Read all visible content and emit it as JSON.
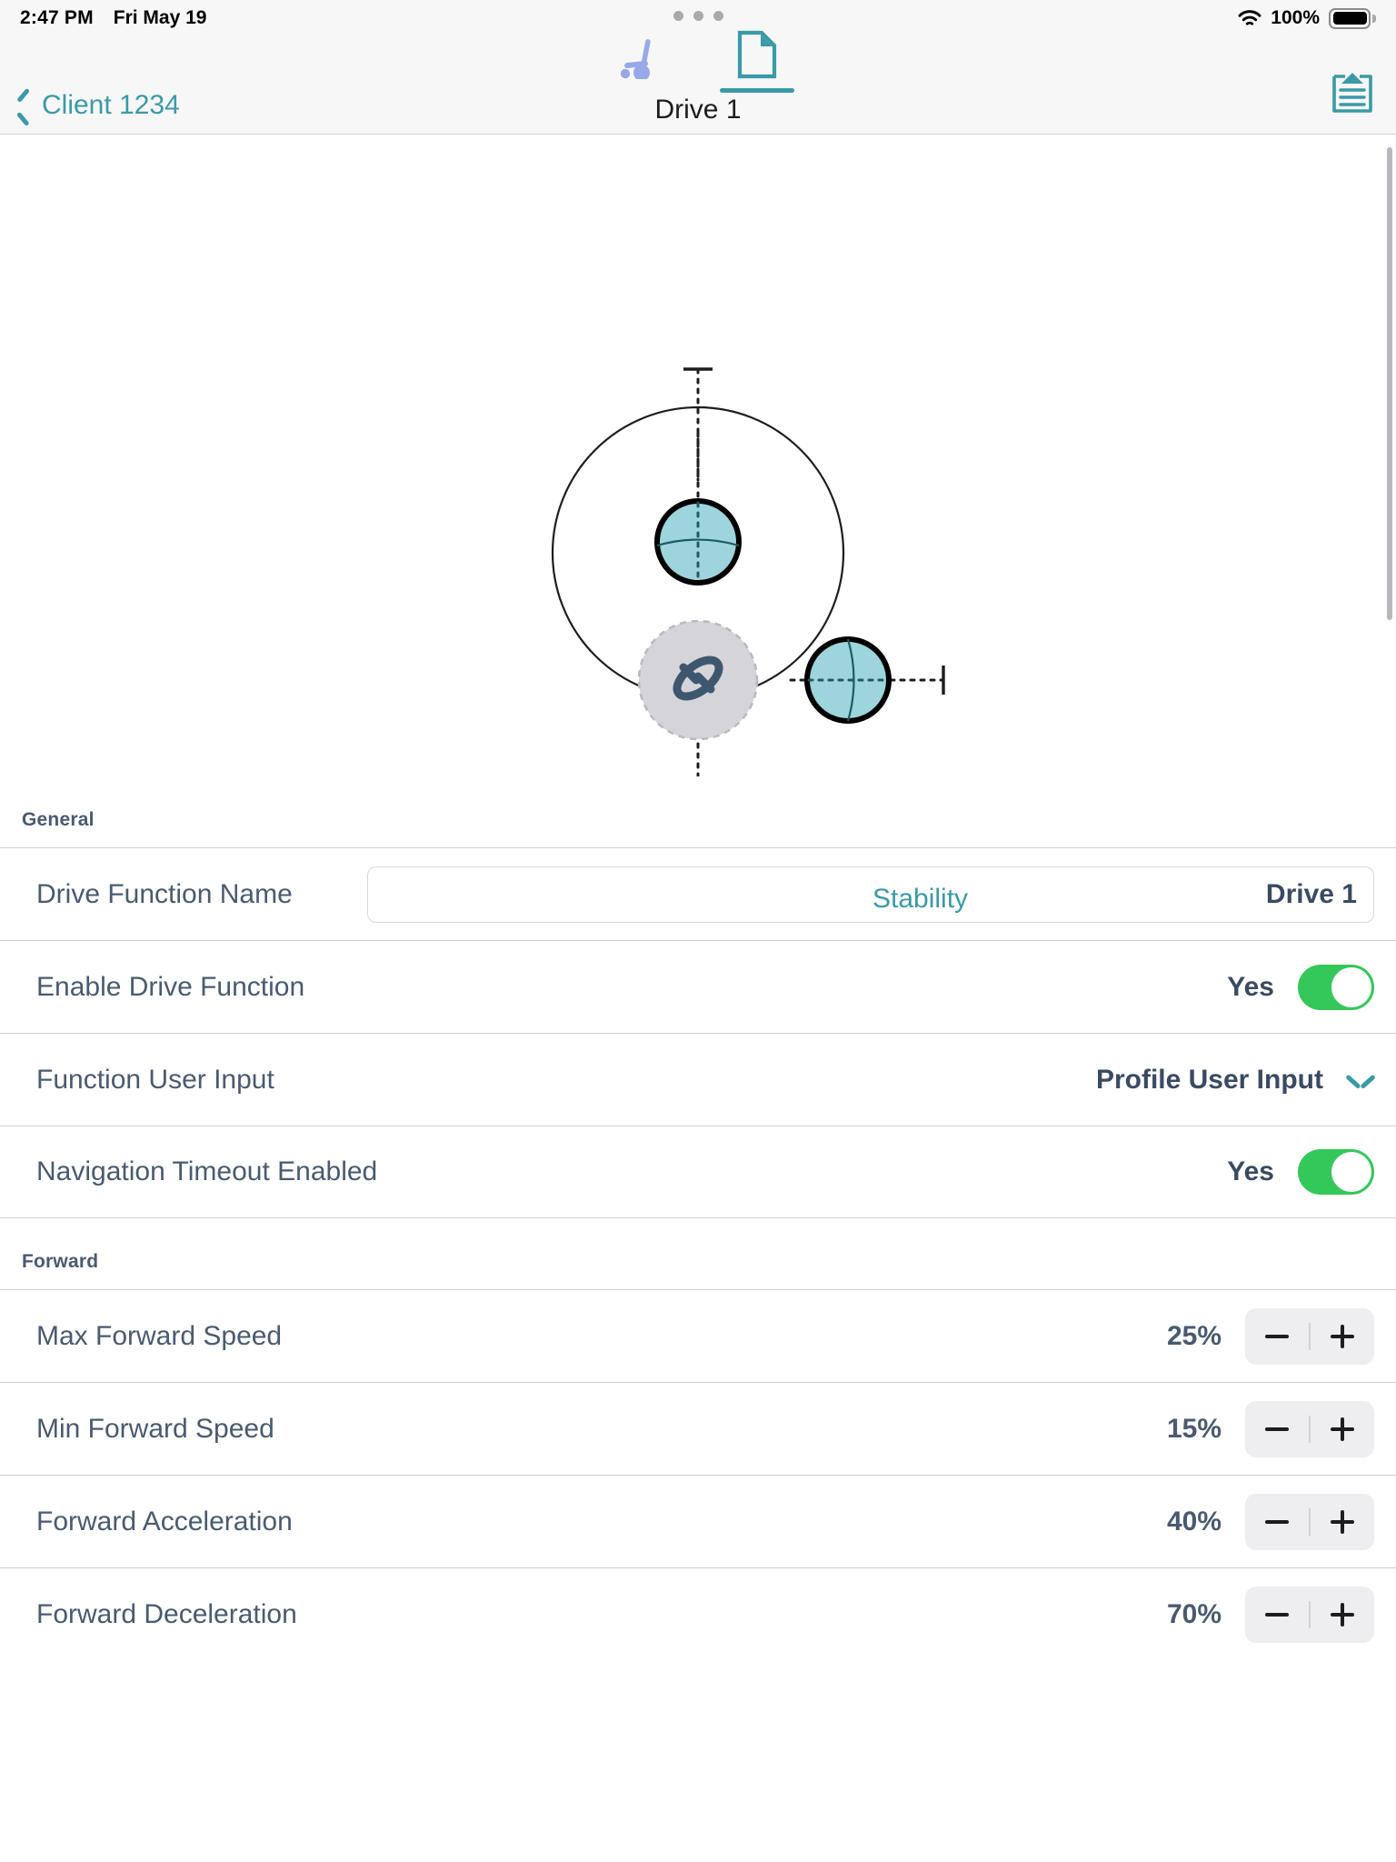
{
  "status_bar": {
    "time": "2:47 PM",
    "date": "Fri May 19",
    "battery_percent": "100%",
    "wifi_icon": "wifi-icon",
    "battery_icon": "battery-full-icon",
    "multitask_handle_icon": "three-dots-icon"
  },
  "nav": {
    "back_label": "Client 1234",
    "back_icon": "chevron-left-icon",
    "title": "Drive 1",
    "tabs": [
      {
        "icon": "wheelchair-icon",
        "name": "tab-wheelchair",
        "active": false
      },
      {
        "icon": "document-icon",
        "name": "tab-document",
        "active": true
      }
    ],
    "right_action_icon": "clipboard-list-icon"
  },
  "diagram": {
    "label": "Stability",
    "center_icon": "stability-orbit-icon",
    "nodes": [
      "top",
      "right",
      "bottom"
    ],
    "colors": {
      "node_fill": "#9ed4db",
      "node_stroke": "#000000",
      "center_fill": "#d4d4d9",
      "center_glyph": "#3f566f",
      "accent": "#3a9aa7"
    }
  },
  "sections": [
    {
      "title": "General",
      "rows": [
        {
          "label": "Drive Function Name",
          "type": "textfield",
          "value": "Drive 1",
          "placeholder": ""
        },
        {
          "label": "Enable Drive Function",
          "type": "toggle",
          "value": "Yes",
          "on": true
        },
        {
          "label": "Function User Input",
          "type": "select",
          "value": "Profile User Input",
          "chevron": "chevron-down-icon"
        },
        {
          "label": "Navigation Timeout Enabled",
          "type": "toggle",
          "value": "Yes",
          "on": true
        }
      ]
    },
    {
      "title": "Forward",
      "rows": [
        {
          "label": "Max Forward Speed",
          "type": "stepper",
          "value": "25%"
        },
        {
          "label": "Min Forward Speed",
          "type": "stepper",
          "value": "15%"
        },
        {
          "label": "Forward Acceleration",
          "type": "stepper",
          "value": "40%"
        },
        {
          "label": "Forward Deceleration",
          "type": "stepper",
          "value": "70%"
        }
      ]
    }
  ],
  "stepper": {
    "minus_icon": "minus-icon",
    "plus_icon": "plus-icon"
  }
}
